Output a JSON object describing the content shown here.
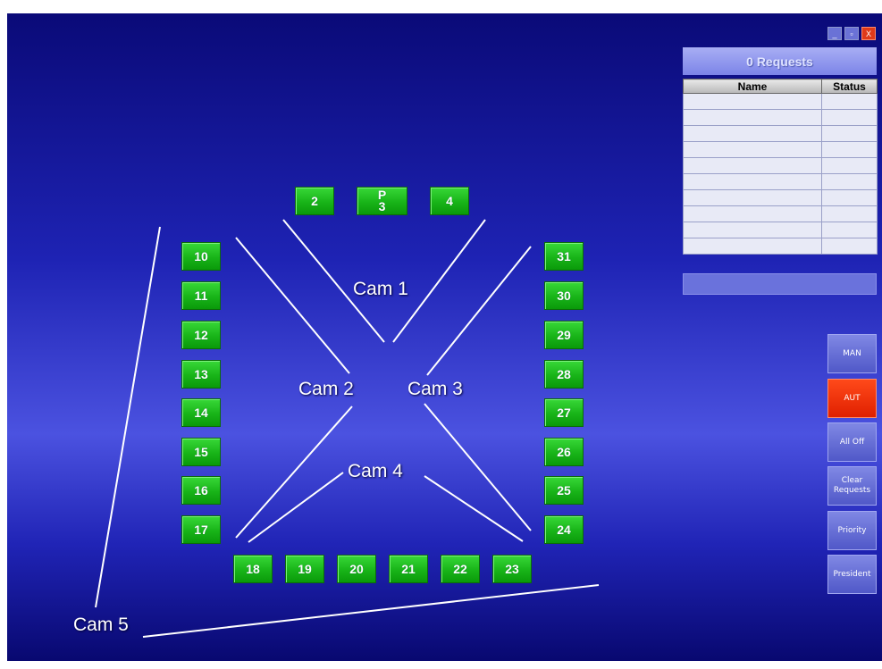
{
  "window_controls": {
    "minimize": "_",
    "maximize": "▫",
    "close": "X"
  },
  "requests": {
    "header": "0 Requests",
    "columns": [
      "Name",
      "Status"
    ],
    "rows": [
      [
        "",
        ""
      ],
      [
        "",
        ""
      ],
      [
        "",
        ""
      ],
      [
        "",
        ""
      ],
      [
        "",
        ""
      ],
      [
        "",
        ""
      ],
      [
        "",
        ""
      ],
      [
        "",
        ""
      ],
      [
        "",
        ""
      ],
      [
        "",
        ""
      ]
    ]
  },
  "side_buttons": {
    "man": "MAN",
    "aut": "AUT",
    "all_off": "All Off",
    "clear_requests": "Clear\nRequests",
    "priority": "Priority",
    "president": "President"
  },
  "cameras": {
    "cam1": "Cam 1",
    "cam2": "Cam 2",
    "cam3": "Cam 3",
    "cam4": "Cam 4",
    "cam5": "Cam 5"
  },
  "seats": {
    "top": {
      "s2": "2",
      "p_label": "P",
      "p_num": "3",
      "s4": "4"
    },
    "left": {
      "s10": "10",
      "s11": "11",
      "s12": "12",
      "s13": "13",
      "s14": "14",
      "s15": "15",
      "s16": "16",
      "s17": "17"
    },
    "bottom": {
      "s18": "18",
      "s19": "19",
      "s20": "20",
      "s21": "21",
      "s22": "22",
      "s23": "23"
    },
    "right": {
      "s31": "31",
      "s30": "30",
      "s29": "29",
      "s28": "28",
      "s27": "27",
      "s26": "26",
      "s25": "25",
      "s24": "24"
    }
  },
  "colors": {
    "background_top": "#0a0a78",
    "background_mid": "#4b52e0",
    "seat_green": "#18b418",
    "active_red": "#e02000",
    "panel_lavender": "#8c94ec"
  }
}
